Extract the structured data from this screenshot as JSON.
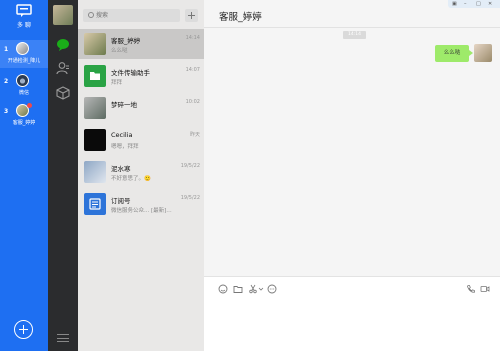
{
  "multi": {
    "title": "多 聊",
    "accounts": [
      {
        "num": "1",
        "name": "开通检测_降儿",
        "active": true
      },
      {
        "num": "2",
        "name": "微信",
        "active": false
      },
      {
        "num": "3",
        "name": "客服_婷婷",
        "active": false
      }
    ]
  },
  "search": {
    "placeholder": "搜索"
  },
  "chats": [
    {
      "name": "客服_婷婷",
      "msg": "么么哒",
      "time": "14:14"
    },
    {
      "name": "文件传输助手",
      "msg": "拜拜",
      "time": "14:07"
    },
    {
      "name": "梦碎一地",
      "msg": "",
      "time": "10:02"
    },
    {
      "name": "Cecilia",
      "msg": "嗯嗯，拜拜",
      "time": "昨天"
    },
    {
      "name": "泥水寒",
      "msg": "不好意思了。🙂",
      "time": "19/5/22"
    },
    {
      "name": "订阅号",
      "msg": "微信服务公众... [最新]…",
      "time": "19/5/22"
    }
  ],
  "conversation": {
    "title": "客服_婷婷",
    "timestamp": "14:14",
    "message": "么么哒"
  },
  "colors": {
    "accent": "#1e6ff2",
    "nav": "#2b2c2e",
    "bubble": "#9eea6a"
  }
}
